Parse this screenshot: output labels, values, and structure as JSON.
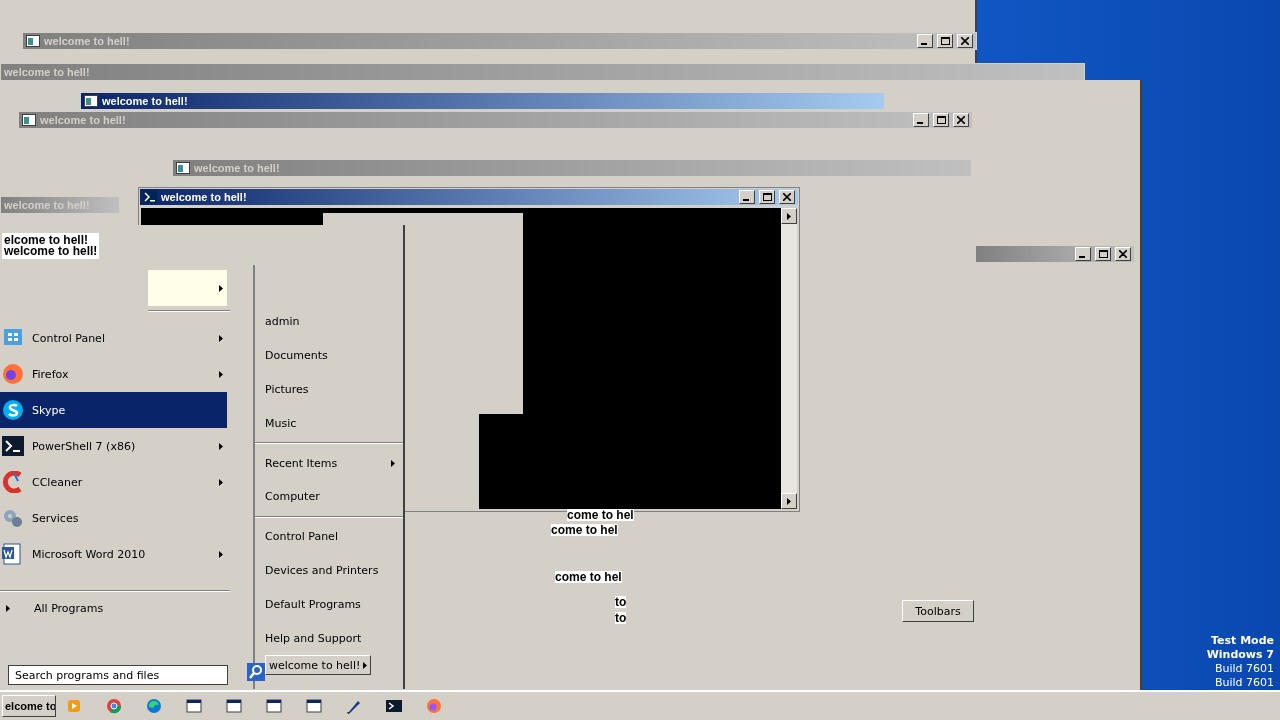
{
  "windows": [
    {
      "title": "welcome to hell!",
      "active": false,
      "controls": true
    },
    {
      "title": "welcome to hell!",
      "active": false,
      "controls": false
    },
    {
      "title": "welcome to hell!",
      "active": true,
      "controls": false
    },
    {
      "title": "welcome to hell!",
      "active": false,
      "controls": true
    },
    {
      "title": "welcome to hell!",
      "active": false,
      "controls": false
    },
    {
      "title": "welcome to hell!",
      "active": false,
      "controls": false
    }
  ],
  "right_window": {
    "active": false,
    "controls": true
  },
  "console": {
    "title": "welcome to hell!",
    "active": true
  },
  "fragments": [
    "come to hel",
    "come to hel",
    "come to hel",
    "to",
    "to"
  ],
  "toolbars_button": "Toolbars",
  "start_menu": {
    "header": [
      "elcome to hell!",
      "welcome to hell!"
    ],
    "blank_item": {
      "submenu": true
    },
    "programs": [
      {
        "label": "Control Panel",
        "submenu": true,
        "selected": false
      },
      {
        "label": "Firefox",
        "submenu": true,
        "selected": false
      },
      {
        "label": "Skype",
        "submenu": false,
        "selected": true
      },
      {
        "label": "PowerShell 7 (x86)",
        "submenu": true,
        "selected": false
      },
      {
        "label": "CCleaner",
        "submenu": true,
        "selected": false
      },
      {
        "label": "Services",
        "submenu": false,
        "selected": false
      },
      {
        "label": "Microsoft Word 2010",
        "submenu": true,
        "selected": false
      }
    ],
    "all_programs": "All Programs",
    "search": {
      "placeholder": "Search programs and files"
    },
    "places": [
      [
        {
          "label": "admin",
          "submenu": false
        },
        {
          "label": "Documents",
          "submenu": false
        },
        {
          "label": "Pictures",
          "submenu": false
        },
        {
          "label": "Music",
          "submenu": false
        }
      ],
      [
        {
          "label": "Recent Items",
          "submenu": true
        },
        {
          "label": "Computer",
          "submenu": false
        }
      ],
      [
        {
          "label": "Control Panel",
          "submenu": false
        },
        {
          "label": "Devices and Printers",
          "submenu": false
        },
        {
          "label": "Default Programs",
          "submenu": false
        },
        {
          "label": "Help and Support",
          "submenu": false
        }
      ]
    ],
    "shutdown": {
      "label": "welcome to hell!"
    }
  },
  "watermark": [
    "Test Mode",
    "Windows 7",
    "Build 7601",
    "Build 7601"
  ],
  "taskbar": {
    "start_label": "elcome to"
  }
}
